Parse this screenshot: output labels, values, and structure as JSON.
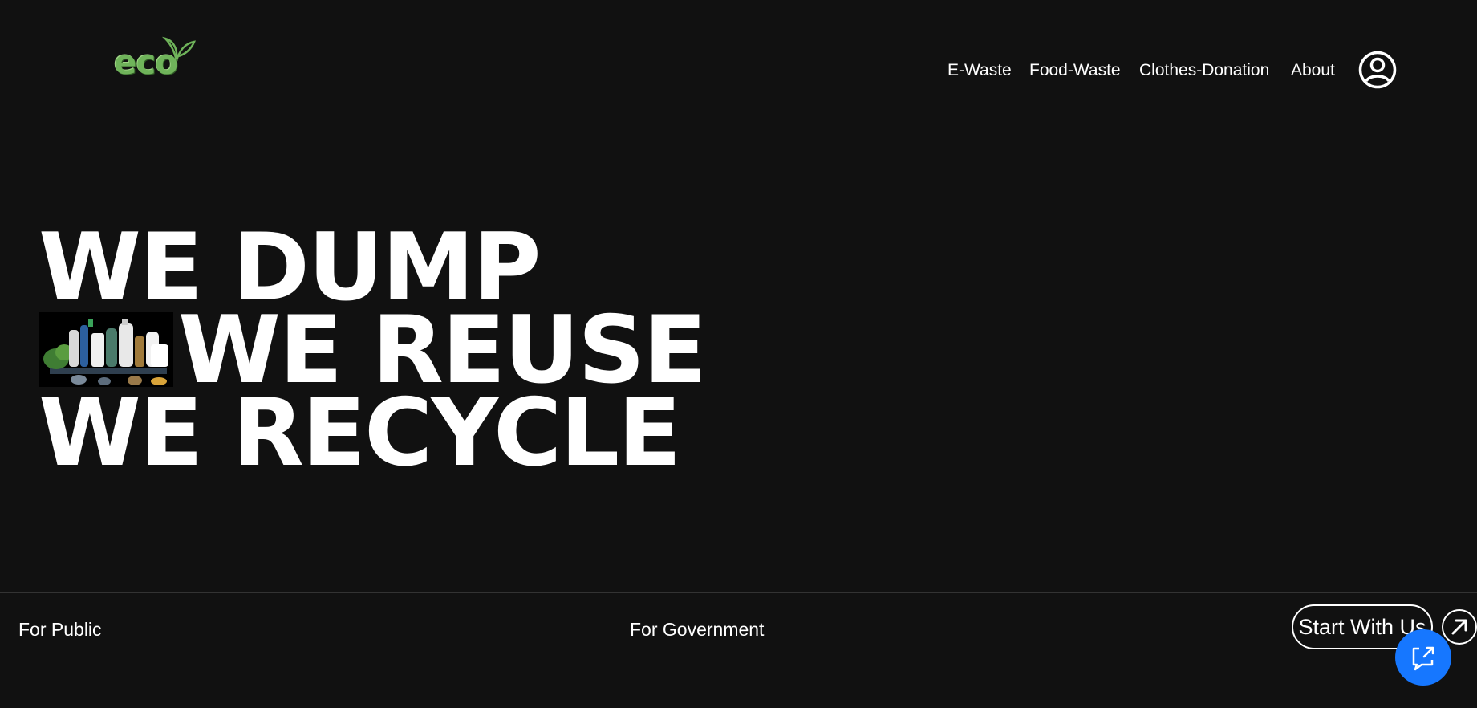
{
  "logo": {
    "text": "eco",
    "icon": "leaf-icon",
    "color": "#6fb35a"
  },
  "nav": {
    "items": [
      {
        "label": "E-Waste"
      },
      {
        "label": "Food-Waste"
      },
      {
        "label": "Clothes-Donation"
      },
      {
        "label": "About"
      }
    ],
    "profile_icon": "user-circle-icon"
  },
  "hero": {
    "line1": "WE DUMP",
    "line2": "WE REUSE",
    "line3": "WE RECYCLE",
    "image": "waste-items-photo"
  },
  "footer": {
    "public_label": "For Public",
    "government_label": "For Government",
    "cta_label": "Start With Us",
    "cta_icon": "arrow-up-right-icon",
    "chat_icon": "chat-share-icon"
  },
  "colors": {
    "background": "#111111",
    "text": "#ffffff",
    "accent": "#1677ff",
    "divider": "#333333"
  }
}
